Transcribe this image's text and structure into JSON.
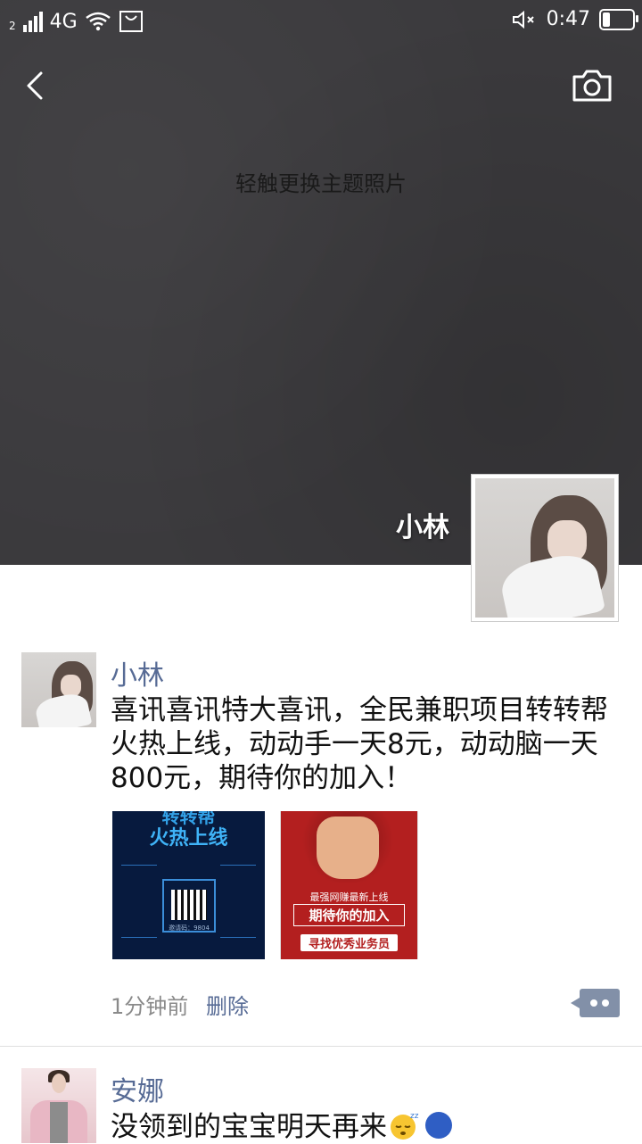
{
  "status_bar": {
    "sim_label": "2",
    "network": "4G",
    "time": "0:47"
  },
  "cover": {
    "hint": "轻触更换主题照片",
    "profile_name": "小林"
  },
  "posts": [
    {
      "name": "小林",
      "text": "喜讯喜讯特大喜讯，全民兼职项目转转帮火热上线，动动手一天8元，动动脑一天800元，期待你的加入！",
      "time": "1分钟前",
      "delete_label": "删除",
      "images": [
        {
          "title_top": "转转帮",
          "title": "火热上线",
          "code": "邀请码：9804"
        },
        {
          "line1": "最强网赚最新上线",
          "line2": "期待你的加入",
          "line3": "寻找优秀业务员"
        }
      ]
    },
    {
      "name": "安娜",
      "text": "没领到的宝宝明天再来"
    }
  ],
  "icons": [
    "back-arrow-icon",
    "camera-icon",
    "signal-icon",
    "wifi-icon",
    "mute-icon",
    "battery-icon",
    "comment-icon",
    "sleepy-emoji-icon",
    "moon-emoji-icon"
  ]
}
